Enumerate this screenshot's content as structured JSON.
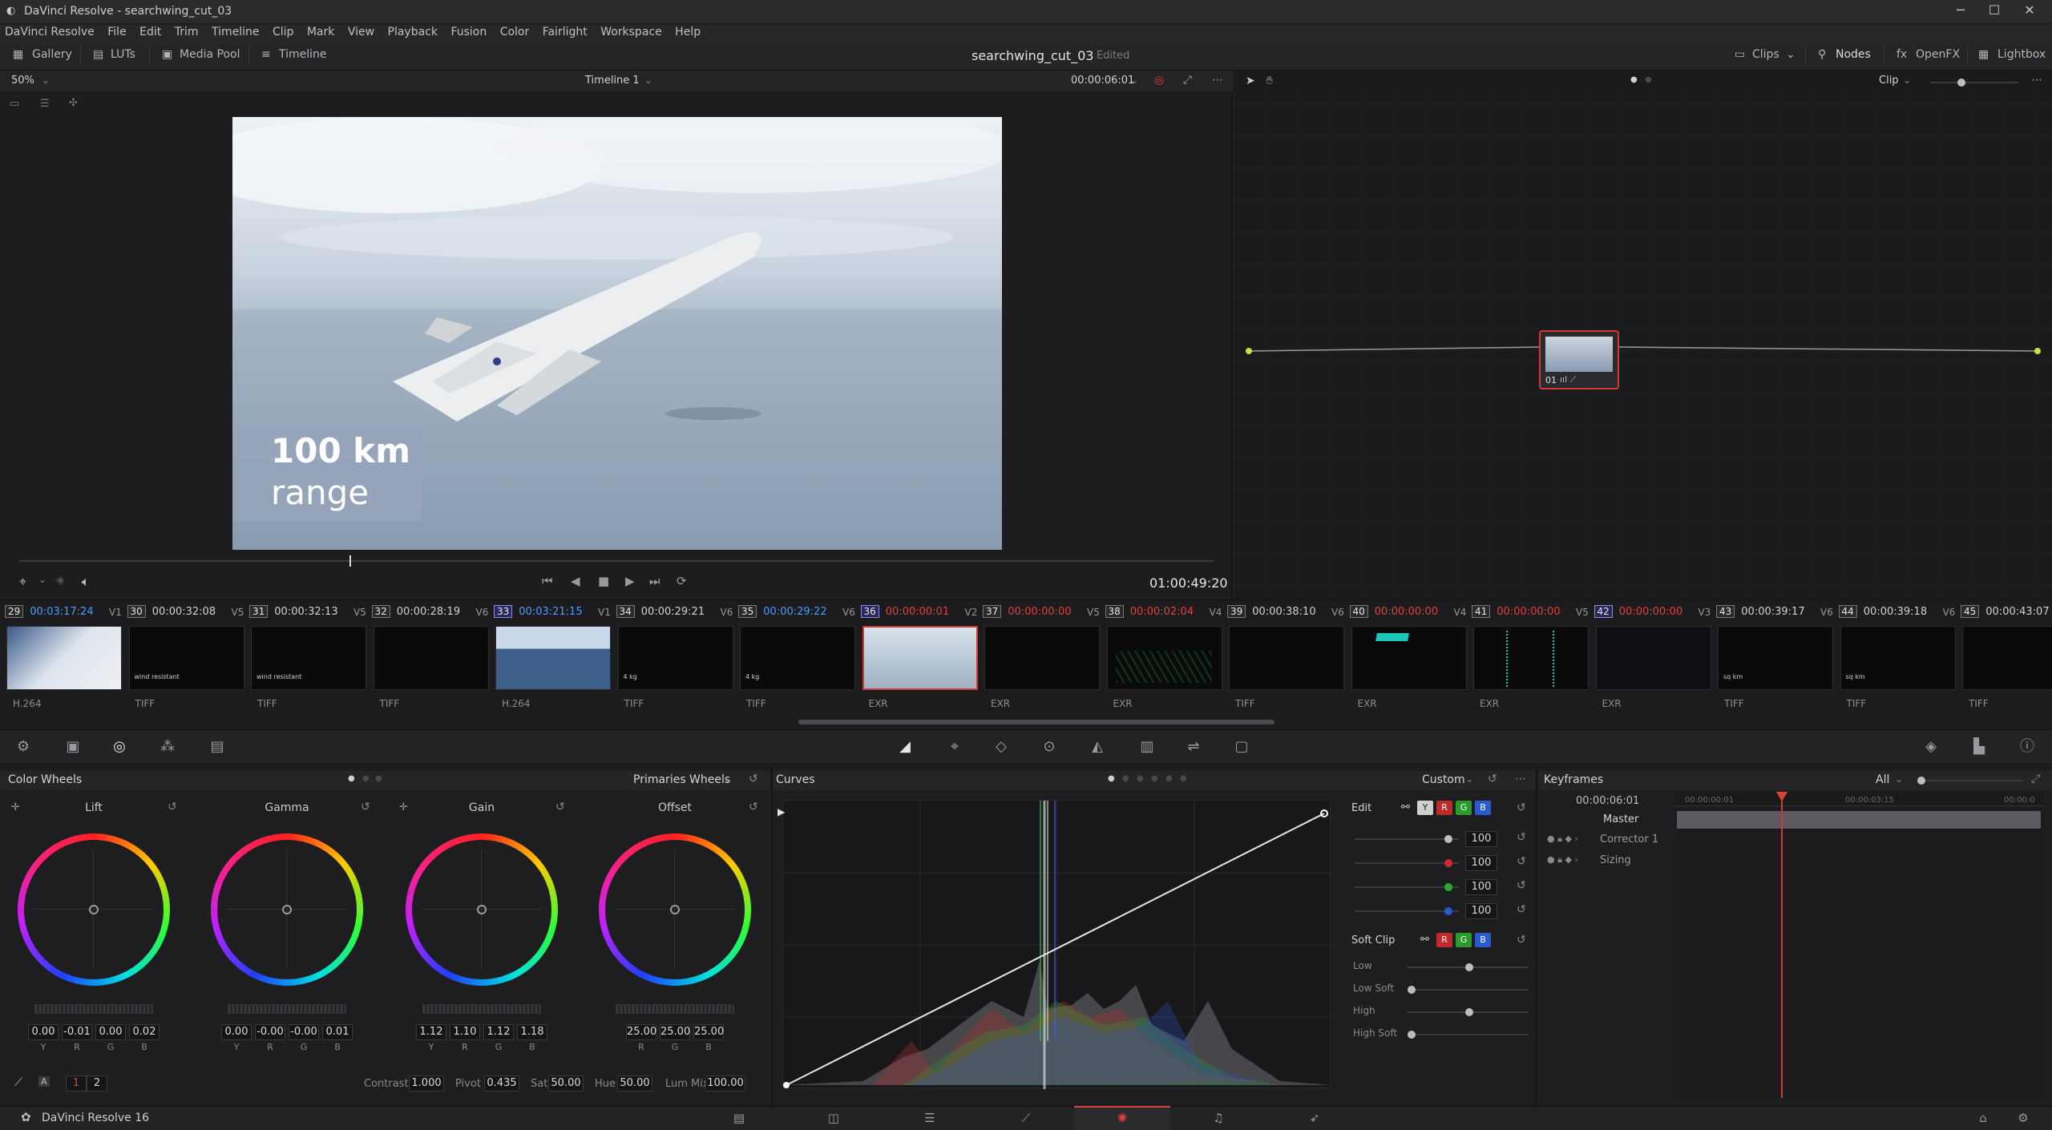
{
  "window": {
    "title": "DaVinci Resolve - searchwing_cut_03"
  },
  "menu": [
    "DaVinci Resolve",
    "File",
    "Edit",
    "Trim",
    "Timeline",
    "Clip",
    "Mark",
    "View",
    "Playback",
    "Fusion",
    "Color",
    "Fairlight",
    "Workspace",
    "Help"
  ],
  "toolbar": {
    "left": [
      "Gallery",
      "LUTs",
      "Media Pool",
      "Timeline"
    ],
    "project": "searchwing_cut_03",
    "status": "Edited",
    "right": [
      "Clips",
      "Nodes",
      "OpenFX",
      "Lightbox"
    ]
  },
  "viewer": {
    "zoom": "50%",
    "timeline": "Timeline 1",
    "timecode": "00:00:06:01",
    "overlay_line1": "100 km",
    "overlay_line2": "range",
    "playhead_tc": "01:00:49:20"
  },
  "nodes": {
    "mode": "Clip",
    "node_label": "01"
  },
  "clips": [
    {
      "num": "29",
      "tc": "00:03:17:24",
      "track": "V1",
      "fmt": "H.264",
      "tcColor": "blue",
      "sel": false,
      "thumb": "plane"
    },
    {
      "num": "30",
      "tc": "00:00:32:08",
      "track": "V5",
      "fmt": "TIFF",
      "tcColor": "",
      "sel": false,
      "thumb": "text",
      "txt": "wind resistant"
    },
    {
      "num": "31",
      "tc": "00:00:32:13",
      "track": "V5",
      "fmt": "TIFF",
      "tcColor": "",
      "sel": false,
      "thumb": "text",
      "txt": "wind resistant"
    },
    {
      "num": "32",
      "tc": "00:00:28:19",
      "track": "V6",
      "fmt": "TIFF",
      "tcColor": "",
      "sel": false,
      "thumb": "black"
    },
    {
      "num": "33",
      "tc": "00:03:21:15",
      "track": "V1",
      "fmt": "H.264",
      "tcColor": "blue",
      "sel": true,
      "thumb": "sea"
    },
    {
      "num": "34",
      "tc": "00:00:29:21",
      "track": "V6",
      "fmt": "TIFF",
      "tcColor": "",
      "sel": false,
      "thumb": "text",
      "txt": "4 kg"
    },
    {
      "num": "35",
      "tc": "00:00:29:22",
      "track": "V6",
      "fmt": "TIFF",
      "tcColor": "blue",
      "sel": false,
      "thumb": "text",
      "txt": "4 kg"
    },
    {
      "num": "36",
      "tc": "00:00:00:01",
      "track": "V2",
      "fmt": "EXR",
      "tcColor": "red",
      "sel": true,
      "thumb": "sky"
    },
    {
      "num": "37",
      "tc": "00:00:00:00",
      "track": "V5",
      "fmt": "EXR",
      "tcColor": "red",
      "sel": false,
      "thumb": "black"
    },
    {
      "num": "38",
      "tc": "00:00:02:04",
      "track": "V4",
      "fmt": "EXR",
      "tcColor": "red",
      "sel": false,
      "thumb": "grid"
    },
    {
      "num": "39",
      "tc": "00:00:38:10",
      "track": "V6",
      "fmt": "TIFF",
      "tcColor": "",
      "sel": false,
      "thumb": "black"
    },
    {
      "num": "40",
      "tc": "00:00:00:00",
      "track": "V4",
      "fmt": "EXR",
      "tcColor": "red",
      "sel": false,
      "thumb": "cyan"
    },
    {
      "num": "41",
      "tc": "00:00:00:00",
      "track": "V5",
      "fmt": "EXR",
      "tcColor": "red",
      "sel": false,
      "thumb": "dots"
    },
    {
      "num": "42",
      "tc": "00:00:00:00",
      "track": "V3",
      "fmt": "EXR",
      "tcColor": "red",
      "sel": true,
      "thumb": "dark"
    },
    {
      "num": "43",
      "tc": "00:00:39:17",
      "track": "V6",
      "fmt": "TIFF",
      "tcColor": "",
      "sel": false,
      "thumb": "text",
      "txt": "sq km"
    },
    {
      "num": "44",
      "tc": "00:00:39:18",
      "track": "V6",
      "fmt": "TIFF",
      "tcColor": "",
      "sel": false,
      "thumb": "text",
      "txt": "sq km"
    },
    {
      "num": "45",
      "tc": "00:00:43:07",
      "track": "",
      "fmt": "TIFF",
      "tcColor": "",
      "sel": false,
      "thumb": "black"
    }
  ],
  "color_wheels": {
    "title": "Color Wheels",
    "mode": "Primaries Wheels",
    "wheels": [
      {
        "name": "Lift",
        "vals": [
          "0.00",
          "-0.01",
          "0.00",
          "0.02"
        ],
        "labels": [
          "Y",
          "R",
          "G",
          "B"
        ]
      },
      {
        "name": "Gamma",
        "vals": [
          "0.00",
          "-0.00",
          "-0.00",
          "0.01"
        ],
        "labels": [
          "Y",
          "R",
          "G",
          "B"
        ]
      },
      {
        "name": "Gain",
        "vals": [
          "1.12",
          "1.10",
          "1.12",
          "1.18"
        ],
        "labels": [
          "Y",
          "R",
          "G",
          "B"
        ]
      },
      {
        "name": "Offset",
        "vals": [
          "25.00",
          "25.00",
          "25.00"
        ],
        "labels": [
          "R",
          "G",
          "B"
        ]
      }
    ],
    "pages": [
      "1",
      "2"
    ],
    "contrast_label": "Contrast",
    "contrast": "1.000",
    "pivot_label": "Pivot",
    "pivot": "0.435",
    "sat_label": "Sat",
    "sat": "50.00",
    "hue_label": "Hue",
    "hue": "50.00",
    "lummix_label": "Lum Mix",
    "lummix": "100.00"
  },
  "curves": {
    "title": "Curves",
    "mode": "Custom",
    "edit_label": "Edit",
    "channels": [
      "Y",
      "R",
      "G",
      "B"
    ],
    "intensity": [
      "100",
      "100",
      "100",
      "100"
    ],
    "softclip_label": "Soft Clip",
    "softclip": [
      "Low",
      "Low Soft",
      "High",
      "High Soft"
    ]
  },
  "keyframes": {
    "title": "Keyframes",
    "filter": "All",
    "timecode": "00:00:06:01",
    "ruler": [
      "00:00:00:01",
      "00:00:03:15",
      "00:00:0"
    ],
    "rows": [
      "Master",
      "Corrector 1",
      "Sizing"
    ]
  },
  "footer": {
    "app": "DaVinci Resolve 16"
  },
  "colors": {
    "accent": "#e0403a",
    "selection": "#8a8ae0",
    "blue_tc": "#4a9cff",
    "red_tc": "#e04040"
  }
}
